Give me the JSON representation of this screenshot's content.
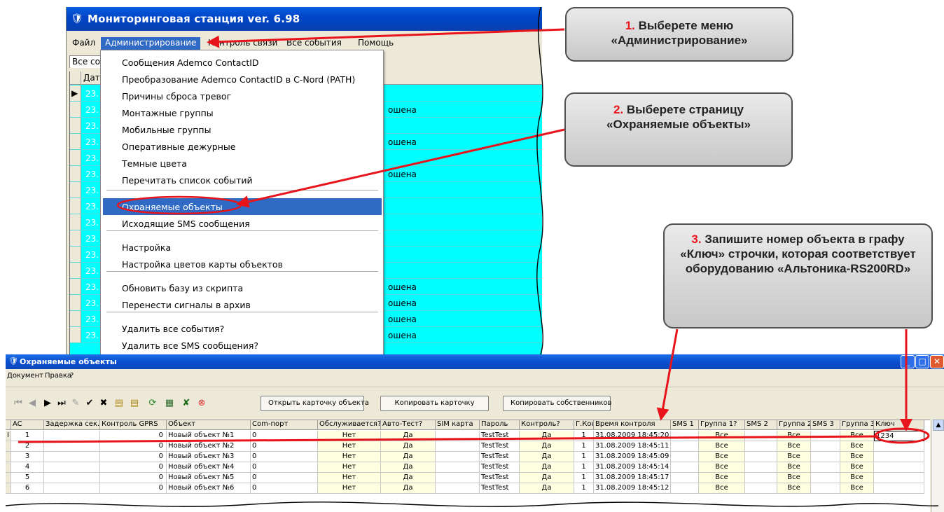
{
  "monitor_window": {
    "title": "Мониторинговая станция ver. 6.98",
    "menu": [
      "Файл",
      "Администрирование",
      "Контроль связи",
      "Все события",
      "Помощь"
    ],
    "active_menu_index": 1,
    "tab_label": "Все со",
    "grid_header_label": "Дат",
    "event_rows": [
      {
        "date": "23.",
        "status": ""
      },
      {
        "date": "23.",
        "status": "ошена"
      },
      {
        "date": "23.",
        "status": ""
      },
      {
        "date": "23.",
        "status": "ошена"
      },
      {
        "date": "23.",
        "status": ""
      },
      {
        "date": "23.",
        "status": "ошена"
      },
      {
        "date": "23.",
        "status": ""
      },
      {
        "date": "23.",
        "status": ""
      },
      {
        "date": "23.",
        "status": ""
      },
      {
        "date": "23.",
        "status": ""
      },
      {
        "date": "23.",
        "status": ""
      },
      {
        "date": "23.",
        "status": ""
      },
      {
        "date": "23.",
        "status": "ошена"
      },
      {
        "date": "23.",
        "status": "ошена"
      },
      {
        "date": "23.",
        "status": "ошена"
      },
      {
        "date": "23.",
        "status": "ошена"
      }
    ]
  },
  "admin_menu": {
    "items": [
      {
        "label": "Сообщения Ademco ContactID"
      },
      {
        "label": "Преобразование Ademco ContactID в C-Nord (PATH)"
      },
      {
        "label": "Причины сброса тревог"
      },
      {
        "label": "Монтажные группы"
      },
      {
        "label": "Мобильные группы"
      },
      {
        "label": "Оперативные дежурные"
      },
      {
        "label": "Темные цвета"
      },
      {
        "label": "Перечитать список событий"
      },
      {
        "label": "Охраняемые объекты",
        "highlighted": true
      },
      {
        "label": "Исходящие SMS сообщения"
      },
      {
        "label": "Настройка"
      },
      {
        "label": "Настройка цветов карты объектов"
      },
      {
        "label": "Обновить базу из скрипта"
      },
      {
        "label": "Перенести сигналы в архив"
      },
      {
        "label": "Удалить все события?"
      },
      {
        "label": "Удалить все SMS сообщения?"
      }
    ]
  },
  "objects_window": {
    "title": "Охраняемые объекты",
    "menu": [
      "Документ",
      "Правка",
      "?"
    ],
    "buttons": {
      "open_card": "Открыть карточку объекта",
      "copy_card": "Копировать карточку",
      "copy_owners": "Копировать собственников"
    },
    "columns": [
      "AC",
      "Задержка сек.",
      "Контроль GPRS",
      "Объект",
      "Com-порт",
      "Обслуживается?",
      "Авто-Тест?",
      "SIM карта",
      "Пароль",
      "Контроль?",
      "Г.Конт.",
      "Время контроля",
      "SMS 1",
      "Группа 1?",
      "SMS 2",
      "Группа 2?",
      "SMS 3",
      "Группа 3?",
      "Ключ"
    ],
    "rows": [
      {
        "ac": "1",
        "delay": "",
        "gprs": "0",
        "object": "Новый объект №1",
        "com": "0",
        "served": "Нет",
        "autotest": "Да",
        "sim": "",
        "password": "TestTest",
        "control": "Да",
        "gkont": "1",
        "time": "31.08.2009 18:45:20",
        "sms1": "",
        "group1": "Все",
        "sms2": "",
        "group2": "Все",
        "sms3": "",
        "group3": "Все",
        "key": "1234"
      },
      {
        "ac": "2",
        "delay": "",
        "gprs": "0",
        "object": "Новый объект №2",
        "com": "0",
        "served": "Нет",
        "autotest": "Да",
        "sim": "",
        "password": "TestTest",
        "control": "Да",
        "gkont": "1",
        "time": "31.08.2009 18:45:11",
        "sms1": "",
        "group1": "Все",
        "sms2": "",
        "group2": "Все",
        "sms3": "",
        "group3": "Все",
        "key": ""
      },
      {
        "ac": "3",
        "delay": "",
        "gprs": "0",
        "object": "Новый объект №3",
        "com": "0",
        "served": "Нет",
        "autotest": "Да",
        "sim": "",
        "password": "TestTest",
        "control": "Да",
        "gkont": "1",
        "time": "31.08.2009 18:45:09",
        "sms1": "",
        "group1": "Все",
        "sms2": "",
        "group2": "Все",
        "sms3": "",
        "group3": "Все",
        "key": ""
      },
      {
        "ac": "4",
        "delay": "",
        "gprs": "0",
        "object": "Новый объект №4",
        "com": "0",
        "served": "Нет",
        "autotest": "Да",
        "sim": "",
        "password": "TestTest",
        "control": "Да",
        "gkont": "1",
        "time": "31.08.2009 18:45:14",
        "sms1": "",
        "group1": "Все",
        "sms2": "",
        "group2": "Все",
        "sms3": "",
        "group3": "Все",
        "key": ""
      },
      {
        "ac": "5",
        "delay": "",
        "gprs": "0",
        "object": "Новый объект №5",
        "com": "0",
        "served": "Нет",
        "autotest": "Да",
        "sim": "",
        "password": "TestTest",
        "control": "Да",
        "gkont": "1",
        "time": "31.08.2009 18:45:17",
        "sms1": "",
        "group1": "Все",
        "sms2": "",
        "group2": "Все",
        "sms3": "",
        "group3": "Все",
        "key": ""
      },
      {
        "ac": "6",
        "delay": "",
        "gprs": "0",
        "object": "Новый объект №6",
        "com": "0",
        "served": "Нет",
        "autotest": "Да",
        "sim": "",
        "password": "TestTest",
        "control": "Да",
        "gkont": "1",
        "time": "31.08.2009 18:45:12",
        "sms1": "",
        "group1": "Все",
        "sms2": "",
        "group2": "Все",
        "sms3": "",
        "group3": "Все",
        "key": ""
      }
    ]
  },
  "callouts": [
    {
      "num": "1.",
      "text": "Выберете меню «Администрирование»"
    },
    {
      "num": "2.",
      "text": "Выберете страницу «Охраняемые объекты»"
    },
    {
      "num": "3.",
      "text": "Запишите номер объекта в графу «Ключ» строчки, которая соответствует оборудованию «Альтоника-RS200RD»"
    }
  ],
  "colors": {
    "accent": "#e8141b",
    "grid_bg": "#00ffff",
    "menu_highlight": "#316ac5",
    "titlebar": "#0a4fd0"
  }
}
